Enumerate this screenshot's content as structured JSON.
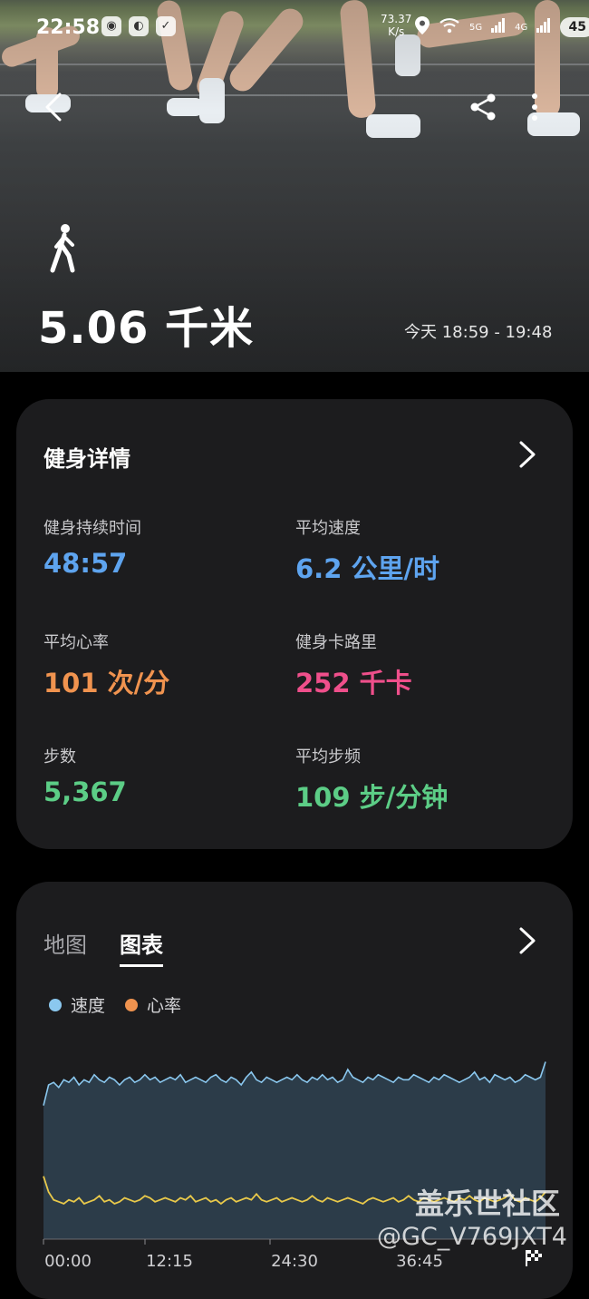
{
  "status_bar": {
    "time": "22:58",
    "net_speed_value": "73.37",
    "net_speed_unit": "K/s",
    "signal_5g": "5G",
    "signal_4g": "4G",
    "battery": "45"
  },
  "hero": {
    "distance": "5.06 千米",
    "time_range": "今天 18:59 - 19:48"
  },
  "fitness_card": {
    "title": "健身详情",
    "metrics": [
      {
        "label": "健身持续时间",
        "value": "48:57",
        "color": "#5ea4ef"
      },
      {
        "label": "平均速度",
        "value": "6.2 公里/时",
        "color": "#5ea4ef"
      },
      {
        "label": "平均心率",
        "value": "101 次/分",
        "color": "#f0934f"
      },
      {
        "label": "健身卡路里",
        "value": "252 千卡",
        "color": "#ef4f8b"
      },
      {
        "label": "步数",
        "value": "5,367",
        "color": "#5ccd86"
      },
      {
        "label": "平均步频",
        "value": "109 步/分钟",
        "color": "#5ccd86"
      }
    ]
  },
  "chart_card": {
    "tabs": [
      {
        "label": "地图",
        "active": false
      },
      {
        "label": "图表",
        "active": true
      }
    ],
    "legend": [
      {
        "label": "速度",
        "color": "#8bc8ef"
      },
      {
        "label": "心率",
        "color": "#f0934f"
      }
    ]
  },
  "chart_data": {
    "type": "line",
    "x_ticks": [
      "00:00",
      "12:15",
      "24:30",
      "36:45"
    ],
    "xlabel": "",
    "ylabel": "",
    "series": [
      {
        "name": "速度",
        "color": "#8bc8ef",
        "fill": "#2d3e4c",
        "values": [
          5.2,
          6.0,
          6.1,
          5.9,
          6.2,
          6.1,
          6.3,
          6.0,
          6.2,
          6.1,
          6.4,
          6.2,
          6.1,
          6.3,
          6.2,
          6.0,
          6.2,
          6.3,
          6.1,
          6.2,
          6.4,
          6.2,
          6.3,
          6.1,
          6.2,
          6.3,
          6.2,
          6.4,
          6.1,
          6.2,
          6.3,
          6.2,
          6.1,
          6.3,
          6.4,
          6.2,
          6.1,
          6.3,
          6.2,
          6.0,
          6.3,
          6.5,
          6.2,
          6.1,
          6.3,
          6.2,
          6.1,
          6.2,
          6.3,
          6.2,
          6.4,
          6.2,
          6.1,
          6.3,
          6.2,
          6.4,
          6.2,
          6.3,
          6.1,
          6.2,
          6.6,
          6.3,
          6.2,
          6.1,
          6.3,
          6.2,
          6.4,
          6.3,
          6.2,
          6.1,
          6.3,
          6.2,
          6.2,
          6.4,
          6.3,
          6.2,
          6.1,
          6.3,
          6.2,
          6.4,
          6.3,
          6.2,
          6.1,
          6.2,
          6.3,
          6.5,
          6.2,
          6.3,
          6.1,
          6.4,
          6.3,
          6.2,
          6.3,
          6.1,
          6.2,
          6.4,
          6.3,
          6.2,
          6.3,
          6.9
        ]
      },
      {
        "name": "心率",
        "color": "#e9c94a",
        "values": [
          112,
          104,
          100,
          99,
          98,
          100,
          99,
          101,
          98,
          99,
          100,
          102,
          99,
          100,
          98,
          99,
          101,
          100,
          99,
          100,
          102,
          101,
          99,
          100,
          101,
          100,
          99,
          101,
          100,
          102,
          99,
          100,
          101,
          99,
          100,
          98,
          100,
          101,
          99,
          100,
          101,
          100,
          103,
          100,
          99,
          100,
          101,
          99,
          100,
          101,
          100,
          99,
          100,
          102,
          100,
          99,
          101,
          100,
          99,
          100,
          101,
          100,
          99,
          98,
          100,
          101,
          100,
          99,
          100,
          101,
          99,
          100,
          102,
          100,
          99,
          101,
          100,
          99,
          100,
          101,
          100,
          99,
          101,
          100,
          102,
          100,
          99,
          101,
          100,
          99,
          100,
          101,
          103,
          100,
          99,
          101,
          100,
          99,
          101,
          104
        ]
      }
    ],
    "speed_range": [
      0,
      7.2
    ],
    "hr_range": [
      80,
      140
    ],
    "grid": false
  }
}
